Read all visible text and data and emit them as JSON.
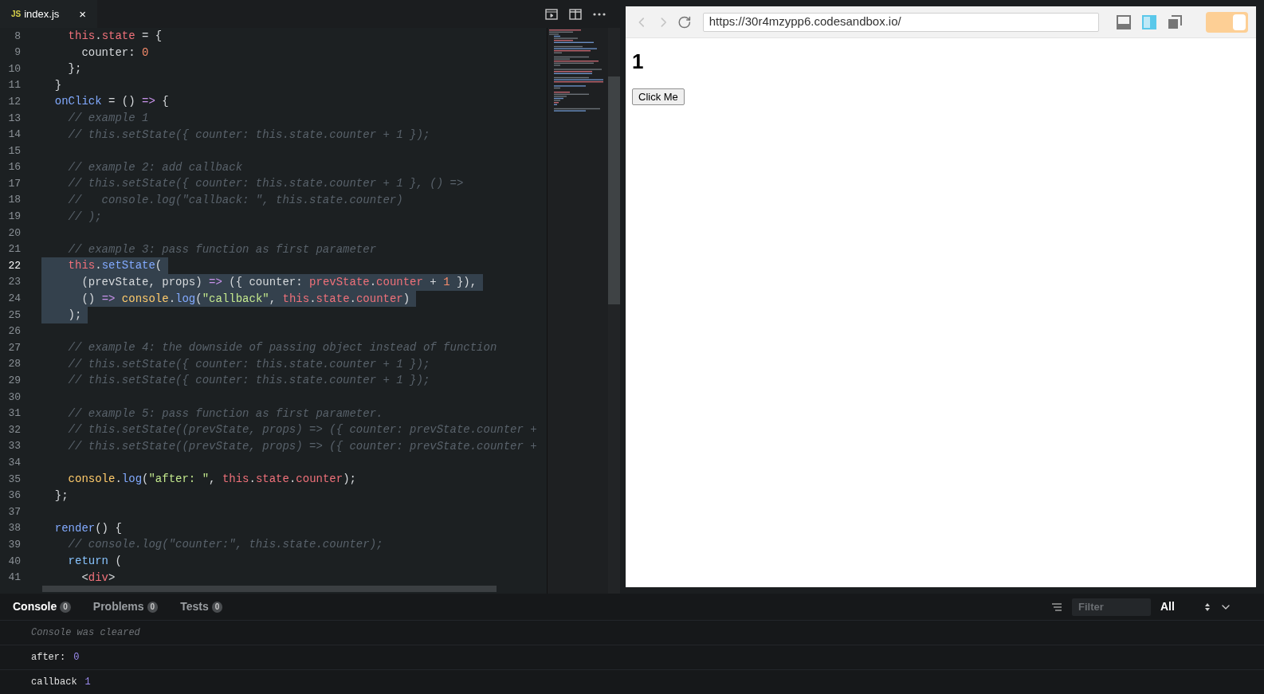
{
  "editor_tab": {
    "badge": "JS",
    "filename": "index.js",
    "close": "×"
  },
  "code_lines": [
    {
      "number": "8",
      "current": false,
      "selected": false,
      "tokens": [
        {
          "text": "    this",
          "kind": "kw"
        },
        {
          "text": ".",
          "kind": "p"
        },
        {
          "text": "state",
          "kind": "kw"
        },
        {
          "text": " = {",
          "kind": "p"
        }
      ]
    },
    {
      "number": "9",
      "current": false,
      "selected": false,
      "tokens": [
        {
          "text": "      counter: ",
          "kind": "p"
        },
        {
          "text": "0",
          "kind": "num"
        }
      ]
    },
    {
      "number": "10",
      "current": false,
      "selected": false,
      "tokens": [
        {
          "text": "    };",
          "kind": "p"
        }
      ]
    },
    {
      "number": "11",
      "current": false,
      "selected": false,
      "tokens": [
        {
          "text": "  }",
          "kind": "p"
        }
      ]
    },
    {
      "number": "12",
      "current": false,
      "selected": false,
      "tokens": [
        {
          "text": "  onClick",
          "kind": "fn"
        },
        {
          "text": " = () ",
          "kind": "p"
        },
        {
          "text": "=>",
          "kind": "op"
        },
        {
          "text": " {",
          "kind": "p"
        }
      ]
    },
    {
      "number": "13",
      "current": false,
      "selected": false,
      "tokens": [
        {
          "text": "    // example 1",
          "kind": "c"
        }
      ]
    },
    {
      "number": "14",
      "current": false,
      "selected": false,
      "tokens": [
        {
          "text": "    // this.setState({ counter: this.state.counter + 1 });",
          "kind": "c"
        }
      ]
    },
    {
      "number": "15",
      "current": false
    },
    {
      "number": "16",
      "current": false,
      "selected": false,
      "tokens": [
        {
          "text": "    // example 2: add callback",
          "kind": "c"
        }
      ]
    },
    {
      "number": "17",
      "current": false,
      "selected": false,
      "tokens": [
        {
          "text": "    // this.setState({ counter: this.state.counter + 1 }, () =>",
          "kind": "c"
        }
      ]
    },
    {
      "number": "18",
      "current": false,
      "selected": false,
      "tokens": [
        {
          "text": "    //   console.log(\"callback: \", this.state.counter)",
          "kind": "c"
        }
      ]
    },
    {
      "number": "19",
      "current": false,
      "selected": false,
      "tokens": [
        {
          "text": "    // );",
          "kind": "c"
        }
      ]
    },
    {
      "number": "20",
      "current": false
    },
    {
      "number": "21",
      "current": false,
      "selected": false,
      "tokens": [
        {
          "text": "    // example 3: pass function as first parameter",
          "kind": "c"
        }
      ]
    },
    {
      "number": "22",
      "current": true,
      "selected": true,
      "tokens": [
        {
          "text": "    this",
          "kind": "kw"
        },
        {
          "text": ".",
          "kind": "p"
        },
        {
          "text": "setState",
          "kind": "fn"
        },
        {
          "text": "(",
          "kind": "p"
        }
      ]
    },
    {
      "number": "23",
      "current": false,
      "selected": true,
      "tokens": [
        {
          "text": "      (prevState, props) ",
          "kind": "p"
        },
        {
          "text": "=>",
          "kind": "op"
        },
        {
          "text": " ({ counter: ",
          "kind": "p"
        },
        {
          "text": "prevState",
          "kind": "kw"
        },
        {
          "text": ".",
          "kind": "p"
        },
        {
          "text": "counter",
          "kind": "kw"
        },
        {
          "text": " + ",
          "kind": "p"
        },
        {
          "text": "1",
          "kind": "num"
        },
        {
          "text": " }),",
          "kind": "p"
        }
      ]
    },
    {
      "number": "24",
      "current": false,
      "selected": true,
      "tokens": [
        {
          "text": "      () ",
          "kind": "p"
        },
        {
          "text": "=>",
          "kind": "op"
        },
        {
          "text": " console",
          "kind": "cls"
        },
        {
          "text": ".",
          "kind": "p"
        },
        {
          "text": "log",
          "kind": "fn"
        },
        {
          "text": "(",
          "kind": "p"
        },
        {
          "text": "\"callback\"",
          "kind": "str"
        },
        {
          "text": ", ",
          "kind": "p"
        },
        {
          "text": "this",
          "kind": "kw"
        },
        {
          "text": ".",
          "kind": "p"
        },
        {
          "text": "state",
          "kind": "kw"
        },
        {
          "text": ".",
          "kind": "p"
        },
        {
          "text": "counter",
          "kind": "kw"
        },
        {
          "text": ")",
          "kind": "p"
        }
      ]
    },
    {
      "number": "25",
      "current": false,
      "selected": true,
      "tokens": [
        {
          "text": "    );",
          "kind": "p"
        }
      ]
    },
    {
      "number": "26",
      "current": false
    },
    {
      "number": "27",
      "current": false,
      "selected": false,
      "tokens": [
        {
          "text": "    // example 4: the downside of passing object instead of function",
          "kind": "c"
        }
      ]
    },
    {
      "number": "28",
      "current": false,
      "selected": false,
      "tokens": [
        {
          "text": "    // this.setState({ counter: this.state.counter + 1 });",
          "kind": "c"
        }
      ]
    },
    {
      "number": "29",
      "current": false,
      "selected": false,
      "tokens": [
        {
          "text": "    // this.setState({ counter: this.state.counter + 1 });",
          "kind": "c"
        }
      ]
    },
    {
      "number": "30",
      "current": false
    },
    {
      "number": "31",
      "current": false,
      "selected": false,
      "tokens": [
        {
          "text": "    // example 5: pass function as first parameter.",
          "kind": "c"
        }
      ]
    },
    {
      "number": "32",
      "current": false,
      "selected": false,
      "tokens": [
        {
          "text": "    // this.setState((prevState, props) => ({ counter: prevState.counter +",
          "kind": "c"
        }
      ]
    },
    {
      "number": "33",
      "current": false,
      "selected": false,
      "tokens": [
        {
          "text": "    // this.setState((prevState, props) => ({ counter: prevState.counter +",
          "kind": "c"
        }
      ]
    },
    {
      "number": "34",
      "current": false
    },
    {
      "number": "35",
      "current": false,
      "selected": false,
      "tokens": [
        {
          "text": "    console",
          "kind": "cls"
        },
        {
          "text": ".",
          "kind": "p"
        },
        {
          "text": "log",
          "kind": "fn"
        },
        {
          "text": "(",
          "kind": "p"
        },
        {
          "text": "\"after: \"",
          "kind": "str"
        },
        {
          "text": ", ",
          "kind": "p"
        },
        {
          "text": "this",
          "kind": "kw"
        },
        {
          "text": ".",
          "kind": "p"
        },
        {
          "text": "state",
          "kind": "kw"
        },
        {
          "text": ".",
          "kind": "p"
        },
        {
          "text": "counter",
          "kind": "kw"
        },
        {
          "text": ");",
          "kind": "p"
        }
      ]
    },
    {
      "number": "36",
      "current": false,
      "selected": false,
      "tokens": [
        {
          "text": "  };",
          "kind": "p"
        }
      ]
    },
    {
      "number": "37",
      "current": false
    },
    {
      "number": "38",
      "current": false,
      "selected": false,
      "tokens": [
        {
          "text": "  render",
          "kind": "fn"
        },
        {
          "text": "() {",
          "kind": "p"
        }
      ]
    },
    {
      "number": "39",
      "current": false,
      "selected": false,
      "tokens": [
        {
          "text": "    // console.log(\"counter:\", this.state.counter);",
          "kind": "c"
        }
      ]
    },
    {
      "number": "40",
      "current": false,
      "selected": false,
      "tokens": [
        {
          "text": "    return",
          "kind": "kw2"
        },
        {
          "text": " (",
          "kind": "p"
        }
      ]
    },
    {
      "number": "41",
      "current": false,
      "selected": false,
      "tokens": [
        {
          "text": "      <",
          "kind": "p"
        },
        {
          "text": "div",
          "kind": "kw"
        },
        {
          "text": ">",
          "kind": "p"
        }
      ]
    }
  ],
  "browser": {
    "url": "https://30r4mzypp6.codesandbox.io/",
    "toggle_on": true,
    "heading": "1",
    "button": "Click Me"
  },
  "console_panel": {
    "tabs": [
      {
        "label": "Console",
        "count": "0",
        "selected": true
      },
      {
        "label": "Problems",
        "count": "0",
        "selected": false
      },
      {
        "label": "Tests",
        "count": "0",
        "selected": false
      }
    ],
    "filter_placeholder": "Filter",
    "level": "All",
    "messages": [
      {
        "kind": "info",
        "text": "Console was cleared"
      },
      {
        "kind": "log",
        "text": "after:",
        "value": "0"
      },
      {
        "kind": "log",
        "text": "callback",
        "value": "1"
      }
    ]
  }
}
